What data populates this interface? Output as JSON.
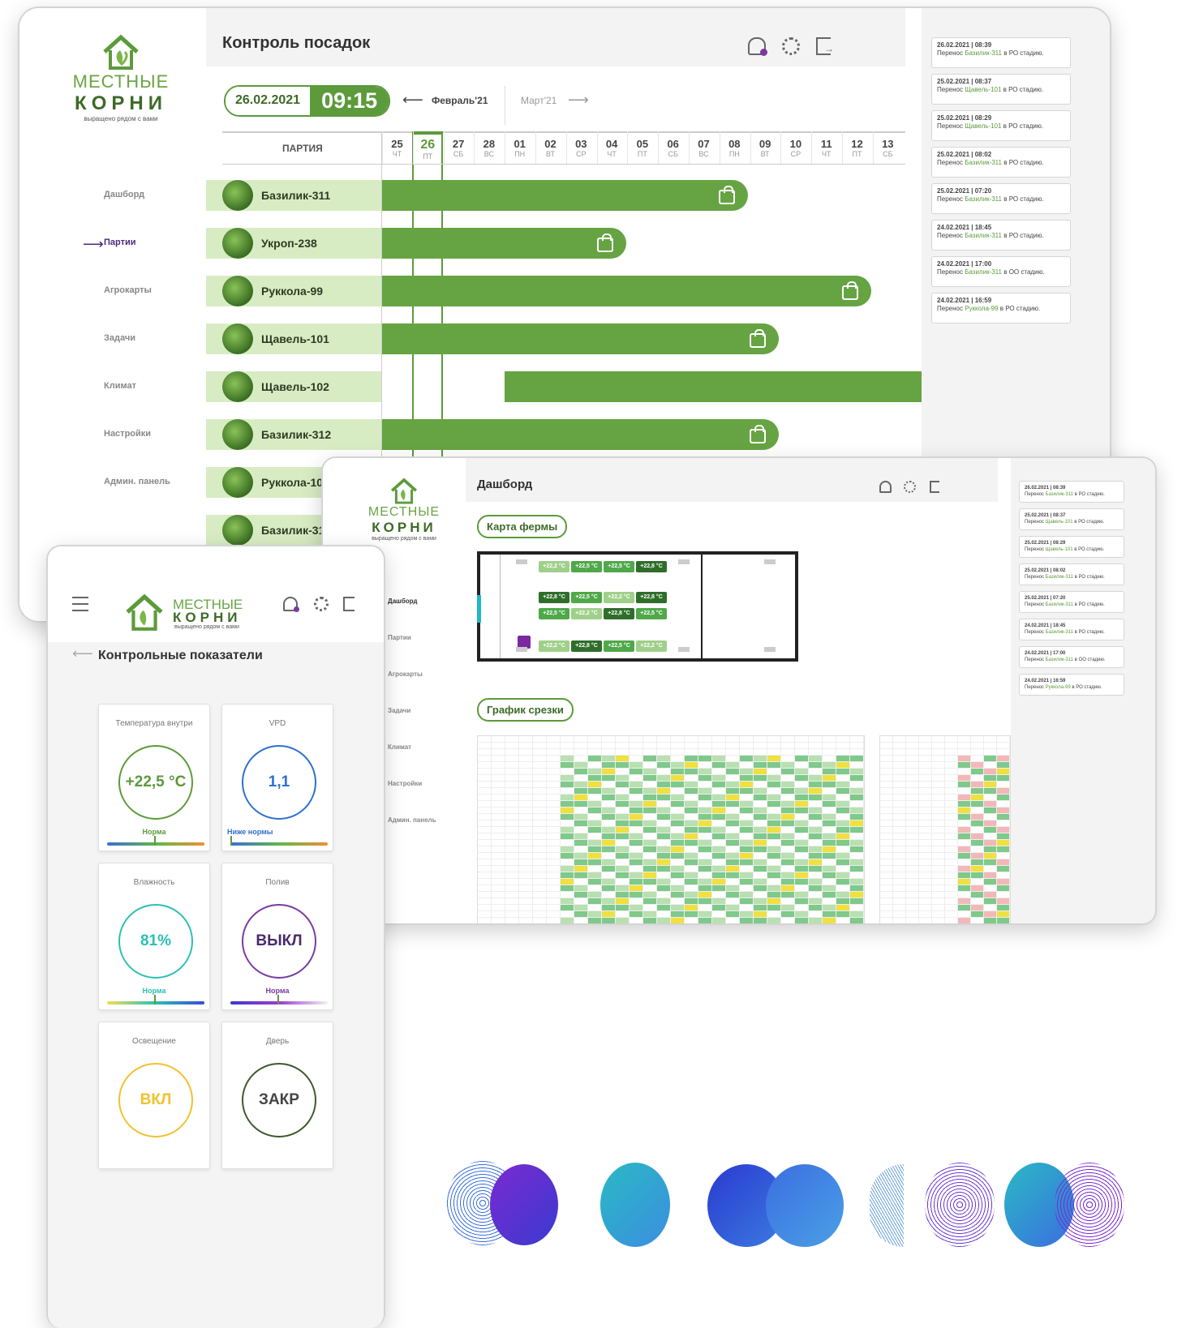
{
  "brand": {
    "line1": "МЕСТНЫЕ",
    "line2": "КОРНИ",
    "line3": "выращено рядом с вами"
  },
  "nav": [
    "Дашборд",
    "Партии",
    "Агрокарты",
    "Задачи",
    "Климат",
    "Настройки",
    "Админ. панель"
  ],
  "plantings": {
    "title": "Контроль посадок",
    "date": "26.02.2021",
    "time": "09:15",
    "prev_month": "Февраль'21",
    "next_month": "Март'21",
    "col_header": "ПАРТИЯ",
    "days": [
      {
        "n": "25",
        "w": "ЧТ"
      },
      {
        "n": "26",
        "w": "ПТ"
      },
      {
        "n": "27",
        "w": "СБ"
      },
      {
        "n": "28",
        "w": "ВС"
      },
      {
        "n": "01",
        "w": "ПН"
      },
      {
        "n": "02",
        "w": "ВТ"
      },
      {
        "n": "03",
        "w": "СР"
      },
      {
        "n": "04",
        "w": "ЧТ"
      },
      {
        "n": "05",
        "w": "ПТ"
      },
      {
        "n": "06",
        "w": "СБ"
      },
      {
        "n": "07",
        "w": "ВС"
      },
      {
        "n": "08",
        "w": "ПН"
      },
      {
        "n": "09",
        "w": "ВТ"
      },
      {
        "n": "10",
        "w": "СР"
      },
      {
        "n": "11",
        "w": "ЧТ"
      },
      {
        "n": "12",
        "w": "ПТ"
      },
      {
        "n": "13",
        "w": "СБ"
      }
    ],
    "batches": [
      "Базилик-311",
      "Укроп-238",
      "Руккола-99",
      "Щавель-101",
      "Щавель-102",
      "Базилик-312",
      "Руккола-10",
      "Базилик-31"
    ]
  },
  "events": [
    {
      "when": "26.02.2021 | 08:39",
      "pre": "Перенос ",
      "item": "Базилик-311",
      "post": " в РО стадию."
    },
    {
      "when": "25.02.2021 | 08:37",
      "pre": "Перенос ",
      "item": "Щавель-101",
      "post": " в РО стадию."
    },
    {
      "when": "25.02.2021 | 08:29",
      "pre": "Перенос ",
      "item": "Щавель-101",
      "post": " в РО стадию."
    },
    {
      "when": "25.02.2021 | 08:02",
      "pre": "Перенос ",
      "item": "Базилик-311",
      "post": " в РО стадию."
    },
    {
      "when": "25.02.2021 | 07:20",
      "pre": "Перенос ",
      "item": "Базилик-311",
      "post": " в РО стадию."
    },
    {
      "when": "24.02.2021 | 18:45",
      "pre": "Перенос ",
      "item": "Базилик-311",
      "post": " в РО стадию."
    },
    {
      "when": "24.02.2021 | 17:00",
      "pre": "Перенос ",
      "item": "Базилик-311",
      "post": " в ОО стадию."
    },
    {
      "when": "24.02.2021 | 16:59",
      "pre": "Перенос ",
      "item": "Руккола-99",
      "post": " в РО стадию."
    }
  ],
  "dashboard": {
    "title": "Дашборд",
    "farm_map": "Карта фермы",
    "cut_chart": "График срезки",
    "temps": [
      "+22,2 °C",
      "+22,5 °C",
      "+22,5 °C",
      "+22,8 °C",
      "+22,8 °C",
      "+22,5 °C",
      "+22,2 °C",
      "+22,8 °C",
      "+22,5 °C",
      "+22,2 °C",
      "+22,8 °C",
      "+22,5 °C",
      "+22,2 °C",
      "+22,8 °C",
      "+22,5 °C",
      "+22,2 °C"
    ]
  },
  "mobile": {
    "title": "Контрольные показатели",
    "cards": [
      {
        "label": "Температура внутри",
        "value": "+22,5 °C",
        "status": "Норма",
        "color": "#5c9a3b"
      },
      {
        "label": "VPD",
        "value": "1,1",
        "status": "Ниже нормы",
        "color": "#2f6fd0"
      },
      {
        "label": "Влажность",
        "value": "81%",
        "status": "Норма",
        "color": "#2ac0b5"
      },
      {
        "label": "Полив",
        "value": "ВЫКЛ",
        "status": "Норма",
        "color": "#7a3aa0"
      },
      {
        "label": "Освещение",
        "value": "ВКЛ",
        "status": "",
        "color": "#f2c12e"
      },
      {
        "label": "Дверь",
        "value": "ЗАКР",
        "status": "",
        "color": "#3c5a2a"
      }
    ]
  }
}
